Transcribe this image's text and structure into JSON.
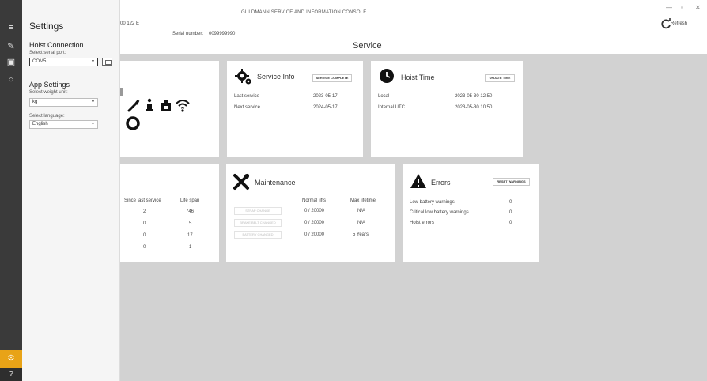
{
  "window": {
    "title": "GULDMANN SERVICE AND INFORMATION CONSOLE",
    "minimize": "—",
    "maximize": "▫",
    "close": "✕"
  },
  "rail": {
    "items": [
      {
        "icon": "hamburger-icon",
        "glyph": "≡"
      },
      {
        "icon": "pencil-icon",
        "glyph": "✎"
      },
      {
        "icon": "screen-icon",
        "glyph": "▣"
      },
      {
        "icon": "circle-icon",
        "glyph": "○"
      }
    ],
    "settings_glyph": "⚙",
    "help_glyph": "?"
  },
  "settings": {
    "title": "Settings",
    "hoist_connection": {
      "heading": "Hoist Connection",
      "port_label": "Select serial port:",
      "port_value": "COM5"
    },
    "app_settings": {
      "heading": "App Settings",
      "weight_label": "Select weight unit:",
      "weight_value": "kg",
      "language_label": "Select language:",
      "language_value": "English"
    }
  },
  "header": {
    "device_id": "00 122 E",
    "serial_label": "Serial number:",
    "serial_value": "0099999990",
    "page_title": "Service",
    "refresh_label": "Refresh"
  },
  "service_info": {
    "title": "Service Info",
    "button": "SERVICE COMPLETE",
    "rows": [
      {
        "label": "Last service",
        "value": "2023-05-17"
      },
      {
        "label": "Next service",
        "value": "2024-05-17"
      }
    ]
  },
  "hoist_time": {
    "title": "Hoist Time",
    "button": "UPDATE TIME",
    "rows": [
      {
        "label": "Local",
        "value": "2023-05-30 12:50"
      },
      {
        "label": "Internal UTC",
        "value": "2023-05-30 10:50"
      }
    ]
  },
  "counters": {
    "headers": [
      "Since last service",
      "Life span"
    ],
    "rows": [
      [
        "2",
        "746"
      ],
      [
        "0",
        "5"
      ],
      [
        "0",
        "17"
      ],
      [
        "0",
        "1"
      ]
    ]
  },
  "maintenance": {
    "title": "Maintenance",
    "headers": [
      "Normal lifts",
      "Max lifetime"
    ],
    "buttons": [
      "STRAP CHANGE",
      "BRAKE BELT CHANGED",
      "BATTERY CHANGED"
    ],
    "rows": [
      {
        "lifts": "0 / 20000",
        "max": "N/A"
      },
      {
        "lifts": "0 / 20000",
        "max": "N/A"
      },
      {
        "lifts": "0 / 20000",
        "max": "5 Years"
      }
    ]
  },
  "errors": {
    "title": "Errors",
    "button": "RESET WARNINGS",
    "rows": [
      {
        "label": "Low battery warnings",
        "value": "0"
      },
      {
        "label": "Critical low battery warnings",
        "value": "0"
      },
      {
        "label": "Hoist errors",
        "value": "0"
      }
    ]
  }
}
